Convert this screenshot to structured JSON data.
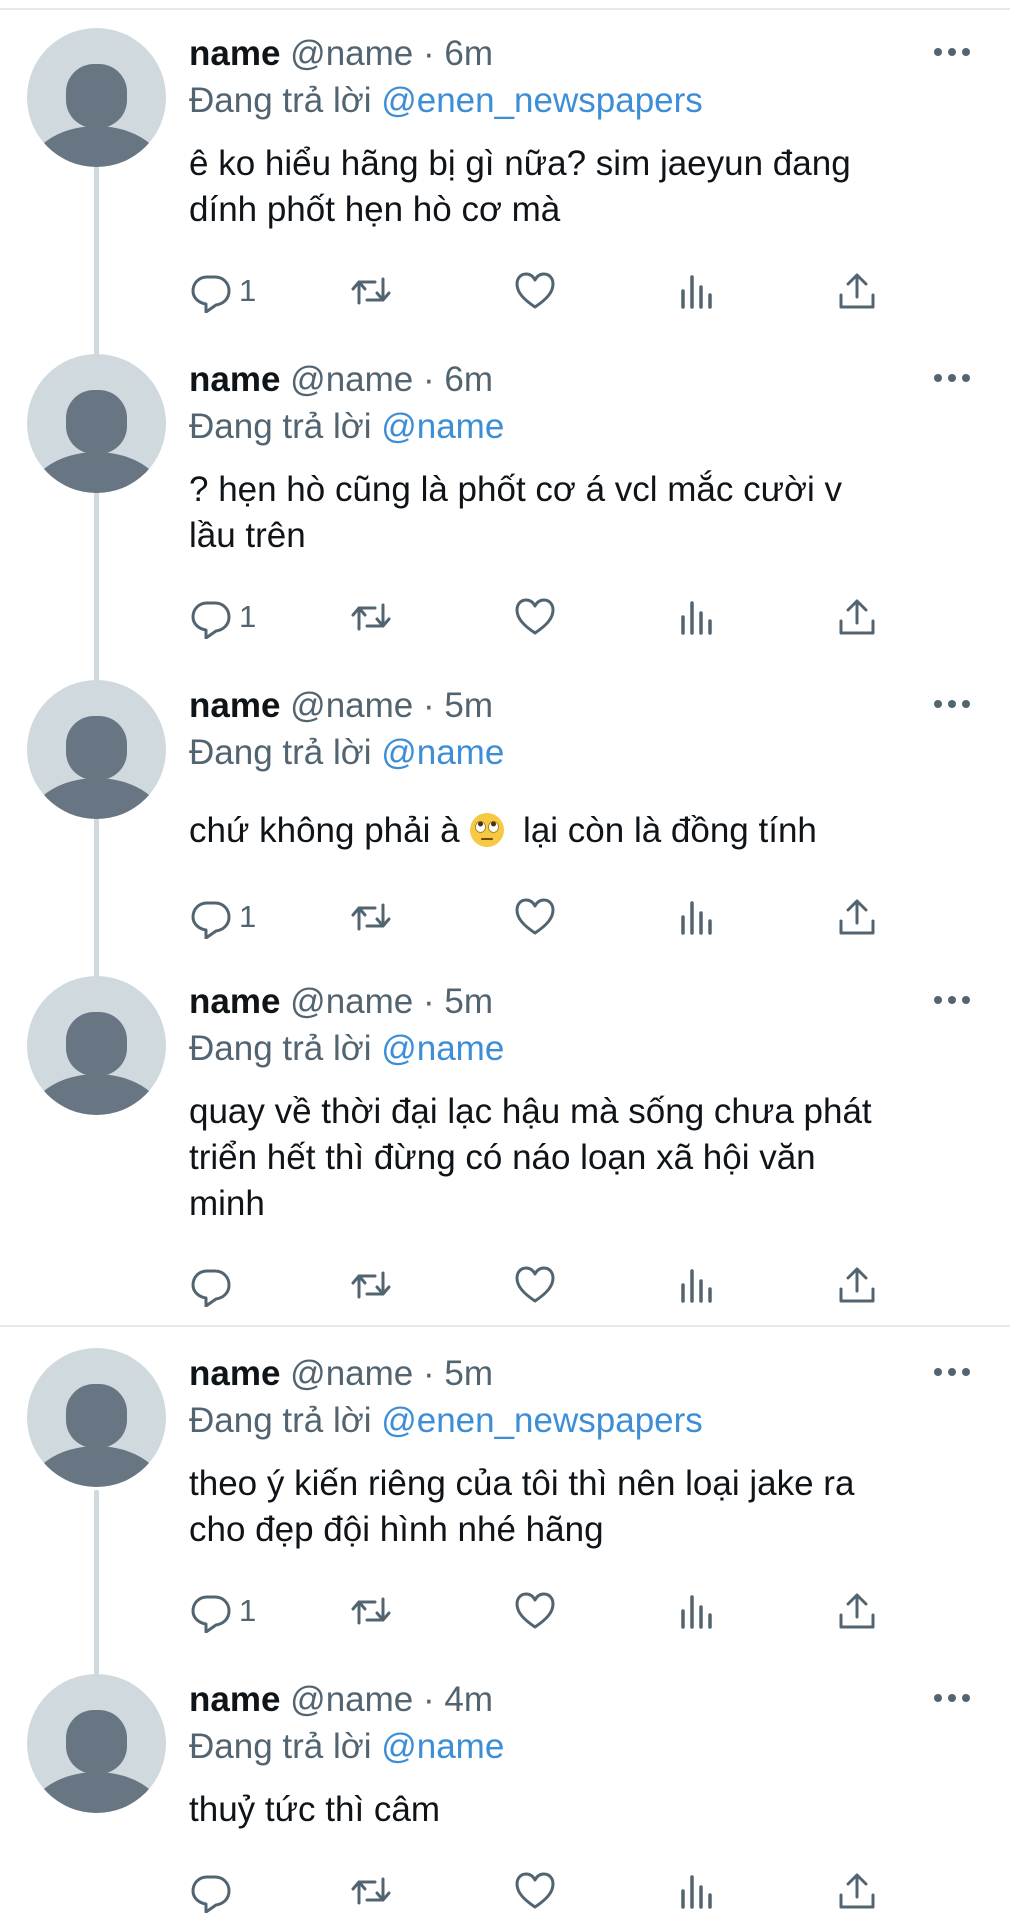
{
  "reply_prefix": "Đang trả lời",
  "tweets": [
    {
      "name": "name",
      "handle": "@name",
      "time": "· 6m",
      "reply_to": "@enen_newspapers",
      "lines": [
        "ê ko hiểu hãng bị gì nữa? sim jaeyun đang",
        "dính phốt hẹn hò cơ mà"
      ],
      "reply_count": "1"
    },
    {
      "name": "name",
      "handle": "@name",
      "time": "· 6m",
      "reply_to": "@name",
      "lines": [
        "? hẹn hò cũng là phốt cơ á vcl mắc cười v",
        "lầu trên"
      ],
      "reply_count": "1"
    },
    {
      "name": "name",
      "handle": "@name",
      "time": "· 5m",
      "reply_to": "@name",
      "lines": [
        "chứ không phải à",
        "lại còn là đồng tính"
      ],
      "reply_count": "1"
    },
    {
      "name": "name",
      "handle": "@name",
      "time": "· 5m",
      "reply_to": "@name",
      "lines": [
        "quay về thời đại lạc hậu mà sống chưa phát",
        "triển hết thì đừng có náo loạn xã hội văn",
        "minh"
      ],
      "reply_count": ""
    },
    {
      "name": "name",
      "handle": "@name",
      "time": "· 5m",
      "reply_to": "@enen_newspapers",
      "lines": [
        "theo ý kiến riêng của tôi thì nên loại jake ra",
        "cho đẹp đội hình nhé hãng"
      ],
      "reply_count": "1"
    },
    {
      "name": "name",
      "handle": "@name",
      "time": "· 4m",
      "reply_to": "@name",
      "lines": [
        "thuỷ tức thì câm"
      ],
      "reply_count": ""
    }
  ],
  "icons": {
    "more": "more-horizontal-icon",
    "reply": "reply-bubble-icon",
    "retweet": "retweet-icon",
    "like": "heart-icon",
    "views": "views-bars-icon",
    "share": "share-upload-icon",
    "emoji": "eye-roll-emoji-icon"
  },
  "colors": {
    "mention": "#3d8ed6",
    "meta": "#536471",
    "text": "#0f1419",
    "avatar_bg": "#cfd9de",
    "avatar_fg": "#687684"
  }
}
